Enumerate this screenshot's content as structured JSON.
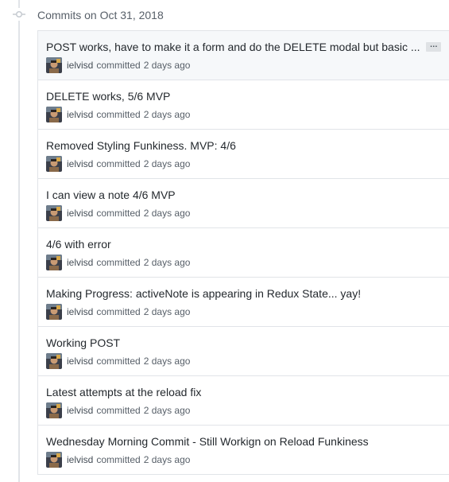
{
  "group": {
    "title": "Commits on Oct 31, 2018",
    "node_icon": "git-commit-icon"
  },
  "colors": {
    "border": "#e1e4e8",
    "highlight_row": "#f6f8fa",
    "muted_text": "#586069"
  },
  "commits": [
    {
      "message": "POST works, have to make it a form and do the DELETE modal but basic ...",
      "author": "ielvisd",
      "action": "committed",
      "time": "2 days ago",
      "has_ellipsis": true,
      "ellipsis_label": "…"
    },
    {
      "message": "DELETE works, 5/6 MVP",
      "author": "ielvisd",
      "action": "committed",
      "time": "2 days ago"
    },
    {
      "message": "Removed Styling Funkiness. MVP: 4/6",
      "author": "ielvisd",
      "action": "committed",
      "time": "2 days ago"
    },
    {
      "message": "I can view a note 4/6 MVP",
      "author": "ielvisd",
      "action": "committed",
      "time": "2 days ago"
    },
    {
      "message": "4/6 with error",
      "author": "ielvisd",
      "action": "committed",
      "time": "2 days ago"
    },
    {
      "message": "Making Progress: activeNote is appearing in Redux State... yay!",
      "author": "ielvisd",
      "action": "committed",
      "time": "2 days ago"
    },
    {
      "message": "Working POST",
      "author": "ielvisd",
      "action": "committed",
      "time": "2 days ago"
    },
    {
      "message": "Latest attempts at the reload fix",
      "author": "ielvisd",
      "action": "committed",
      "time": "2 days ago"
    },
    {
      "message": "Wednesday Morning Commit - Still Workign on Reload Funkiness",
      "author": "ielvisd",
      "action": "committed",
      "time": "2 days ago"
    }
  ]
}
